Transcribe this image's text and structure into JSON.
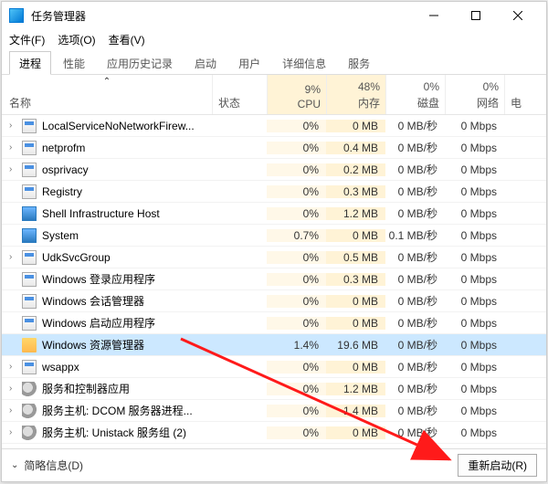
{
  "window": {
    "title": "任务管理器"
  },
  "menubar": [
    "文件(F)",
    "选项(O)",
    "查看(V)"
  ],
  "tabs": [
    "进程",
    "性能",
    "应用历史记录",
    "启动",
    "用户",
    "详细信息",
    "服务"
  ],
  "header": {
    "name": "名称",
    "status": "状态",
    "cols": [
      {
        "pct": "9%",
        "label": "CPU"
      },
      {
        "pct": "48%",
        "label": "内存"
      },
      {
        "pct": "0%",
        "label": "磁盘"
      },
      {
        "pct": "0%",
        "label": "网络"
      }
    ],
    "last": "电"
  },
  "rows": [
    {
      "expand": true,
      "icon": "ico-exe",
      "name": "LocalServiceNoNetworkFirew...",
      "cpu": "0%",
      "mem": "0 MB",
      "disk": "0 MB/秒",
      "net": "0 Mbps"
    },
    {
      "expand": true,
      "icon": "ico-exe",
      "name": "netprofm",
      "cpu": "0%",
      "mem": "0.4 MB",
      "disk": "0 MB/秒",
      "net": "0 Mbps"
    },
    {
      "expand": true,
      "icon": "ico-exe",
      "name": "osprivacy",
      "cpu": "0%",
      "mem": "0.2 MB",
      "disk": "0 MB/秒",
      "net": "0 Mbps"
    },
    {
      "expand": false,
      "icon": "ico-exe",
      "name": "Registry",
      "cpu": "0%",
      "mem": "0.3 MB",
      "disk": "0 MB/秒",
      "net": "0 Mbps"
    },
    {
      "expand": false,
      "icon": "ico-blue",
      "name": "Shell Infrastructure Host",
      "cpu": "0%",
      "mem": "1.2 MB",
      "disk": "0 MB/秒",
      "net": "0 Mbps"
    },
    {
      "expand": false,
      "icon": "ico-blue",
      "name": "System",
      "cpu": "0.7%",
      "mem": "0 MB",
      "disk": "0.1 MB/秒",
      "net": "0 Mbps"
    },
    {
      "expand": true,
      "icon": "ico-exe",
      "name": "UdkSvcGroup",
      "cpu": "0%",
      "mem": "0.5 MB",
      "disk": "0 MB/秒",
      "net": "0 Mbps"
    },
    {
      "expand": false,
      "icon": "ico-exe",
      "name": "Windows 登录应用程序",
      "cpu": "0%",
      "mem": "0.3 MB",
      "disk": "0 MB/秒",
      "net": "0 Mbps"
    },
    {
      "expand": false,
      "icon": "ico-exe",
      "name": "Windows 会话管理器",
      "cpu": "0%",
      "mem": "0 MB",
      "disk": "0 MB/秒",
      "net": "0 Mbps"
    },
    {
      "expand": false,
      "icon": "ico-exe",
      "name": "Windows 启动应用程序",
      "cpu": "0%",
      "mem": "0 MB",
      "disk": "0 MB/秒",
      "net": "0 Mbps"
    },
    {
      "expand": false,
      "icon": "ico-folder",
      "name": "Windows 资源管理器",
      "cpu": "1.4%",
      "mem": "19.6 MB",
      "disk": "0 MB/秒",
      "net": "0 Mbps",
      "selected": true
    },
    {
      "expand": true,
      "icon": "ico-exe",
      "name": "wsappx",
      "cpu": "0%",
      "mem": "0 MB",
      "disk": "0 MB/秒",
      "net": "0 Mbps"
    },
    {
      "expand": true,
      "icon": "ico-svc",
      "name": "服务和控制器应用",
      "cpu": "0%",
      "mem": "1.2 MB",
      "disk": "0 MB/秒",
      "net": "0 Mbps"
    },
    {
      "expand": true,
      "icon": "ico-svc",
      "name": "服务主机: DCOM 服务器进程...",
      "cpu": "0%",
      "mem": "1.4 MB",
      "disk": "0 MB/秒",
      "net": "0 Mbps"
    },
    {
      "expand": true,
      "icon": "ico-svc",
      "name": "服务主机: Unistack 服务组 (2)",
      "cpu": "0%",
      "mem": "0 MB",
      "disk": "0 MB/秒",
      "net": "0 Mbps"
    }
  ],
  "footer": {
    "less": "简略信息(D)",
    "restart": "重新启动(R)"
  }
}
